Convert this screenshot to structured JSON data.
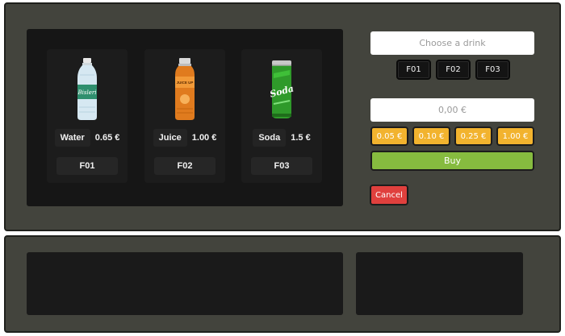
{
  "products": [
    {
      "name": "Water",
      "price": "0.65 €",
      "code": "F01",
      "icon": "water-bottle-icon"
    },
    {
      "name": "Juice",
      "price": "1.00 €",
      "code": "F02",
      "icon": "juice-bottle-icon"
    },
    {
      "name": "Soda",
      "price": "1.5 €",
      "code": "F03",
      "icon": "soda-can-icon"
    }
  ],
  "bottle_label": "Bisleri",
  "juice_label": "JUICE UP",
  "soda_label": "Soda",
  "drink_field": {
    "placeholder": "Choose a drink"
  },
  "select_buttons": [
    "F01",
    "F02",
    "F03"
  ],
  "amount_field": {
    "value": "0,00 €"
  },
  "coins": [
    "0.05 €",
    "0.10 €",
    "0.25 €",
    "1.00 €"
  ],
  "buy_label": "Buy",
  "cancel_label": "Cancel",
  "colors": {
    "panel": "#43443d",
    "display": "#161616",
    "coin": "#f2b32e",
    "buy": "#86bb3f",
    "cancel": "#e0403d"
  }
}
